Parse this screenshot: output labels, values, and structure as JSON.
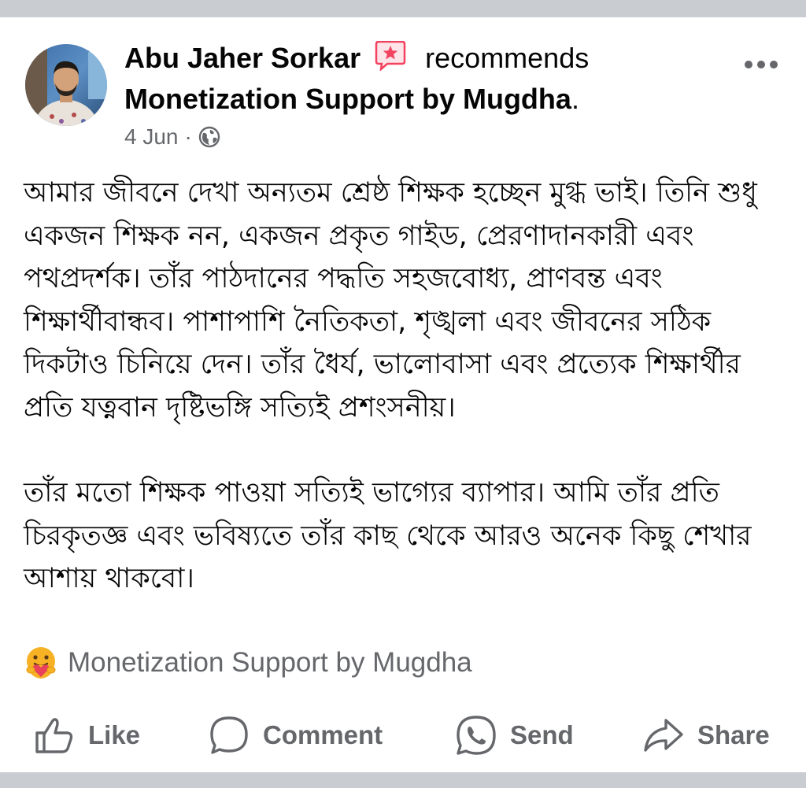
{
  "post": {
    "author_name": "Abu Jaher Sorkar",
    "recommends_text": "recommends",
    "page_name": "Monetization Support by Mugdha",
    "page_name_suffix": ".",
    "date": "4 Jun",
    "separator": "·",
    "privacy_icon": "globe-icon",
    "badge_icon": "recommendation-star-icon",
    "more_icon": "more-horizontal-icon",
    "paragraphs": [
      "আমার জীবনে দেখা অন্যতম শ্রেষ্ঠ শিক্ষক হচ্ছেন মুগ্ধ ভাই। তিনি শুধু একজন শিক্ষক নন, একজন প্রকৃত গাইড, প্রেরণাদানকারী এবং পথপ্রদর্শক। তাঁর পাঠদানের পদ্ধতি সহজবোধ্য, প্রাণবন্ত এবং শিক্ষার্থীবান্ধব। পাশাপাশি নৈতিকতা, শৃঙ্খলা এবং জীবনের সঠিক দিকটাও চিনিয়ে দেন। তাঁর ধৈর্য, ভালোবাসা এবং প্রত্যেক শিক্ষার্থীর প্রতি যত্নবান দৃষ্টিভঙ্গি সত্যিই প্রশংসনীয়।",
      "তাঁর মতো শিক্ষক পাওয়া সত্যিই ভাগ্যের ব্যাপার। আমি তাঁর প্রতি চিরকৃতজ্ঞ এবং ভবিষ্যতে তাঁর কাছ থেকে আরও অনেক কিছু শেখার আশায় থাকবো।"
    ]
  },
  "reaction": {
    "icon": "care-reaction-icon",
    "label": "Monetization Support by Mugdha"
  },
  "actions": {
    "like_label": "Like",
    "comment_label": "Comment",
    "send_label": "Send",
    "share_label": "Share"
  },
  "colors": {
    "text_primary": "#050505",
    "text_secondary": "#65676b",
    "frame": "#c9ccd1",
    "badge_pink": "#f3425f"
  }
}
